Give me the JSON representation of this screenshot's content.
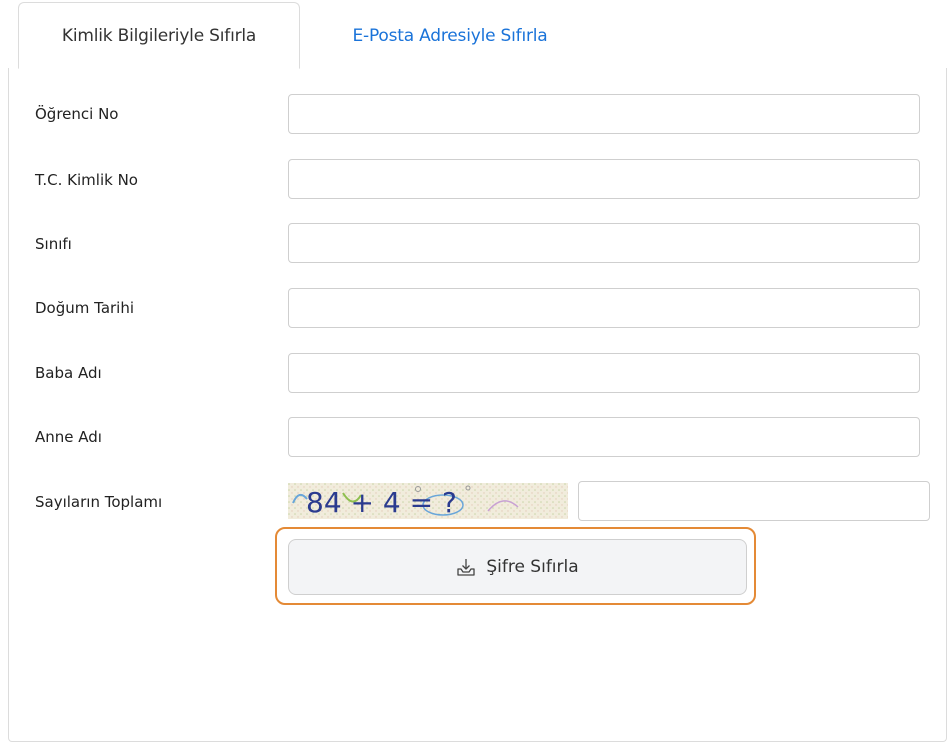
{
  "tabs": [
    {
      "label": "Kimlik Bilgileriyle Sıfırla",
      "active": true
    },
    {
      "label": "E-Posta Adresiyle Sıfırla",
      "active": false
    }
  ],
  "form": {
    "ogrenci_no": {
      "label": "Öğrenci No",
      "value": ""
    },
    "tc_kimlik_no": {
      "label": "T.C. Kimlik No",
      "value": ""
    },
    "sinifi": {
      "label": "Sınıfı",
      "value": ""
    },
    "dogum_tarihi": {
      "label": "Doğum Tarihi",
      "value": ""
    },
    "baba_adi": {
      "label": "Baba Adı",
      "value": ""
    },
    "anne_adi": {
      "label": "Anne Adı",
      "value": ""
    },
    "sayilarin_toplami": {
      "label": "Sayıların Toplamı",
      "value": ""
    }
  },
  "captcha": {
    "text": "84 + 4 = ?"
  },
  "submit": {
    "label": "Şifre Sıfırla",
    "icon": "download-tray-icon"
  },
  "colors": {
    "link_blue": "#1a73d9",
    "focus_orange": "#e48a36"
  }
}
